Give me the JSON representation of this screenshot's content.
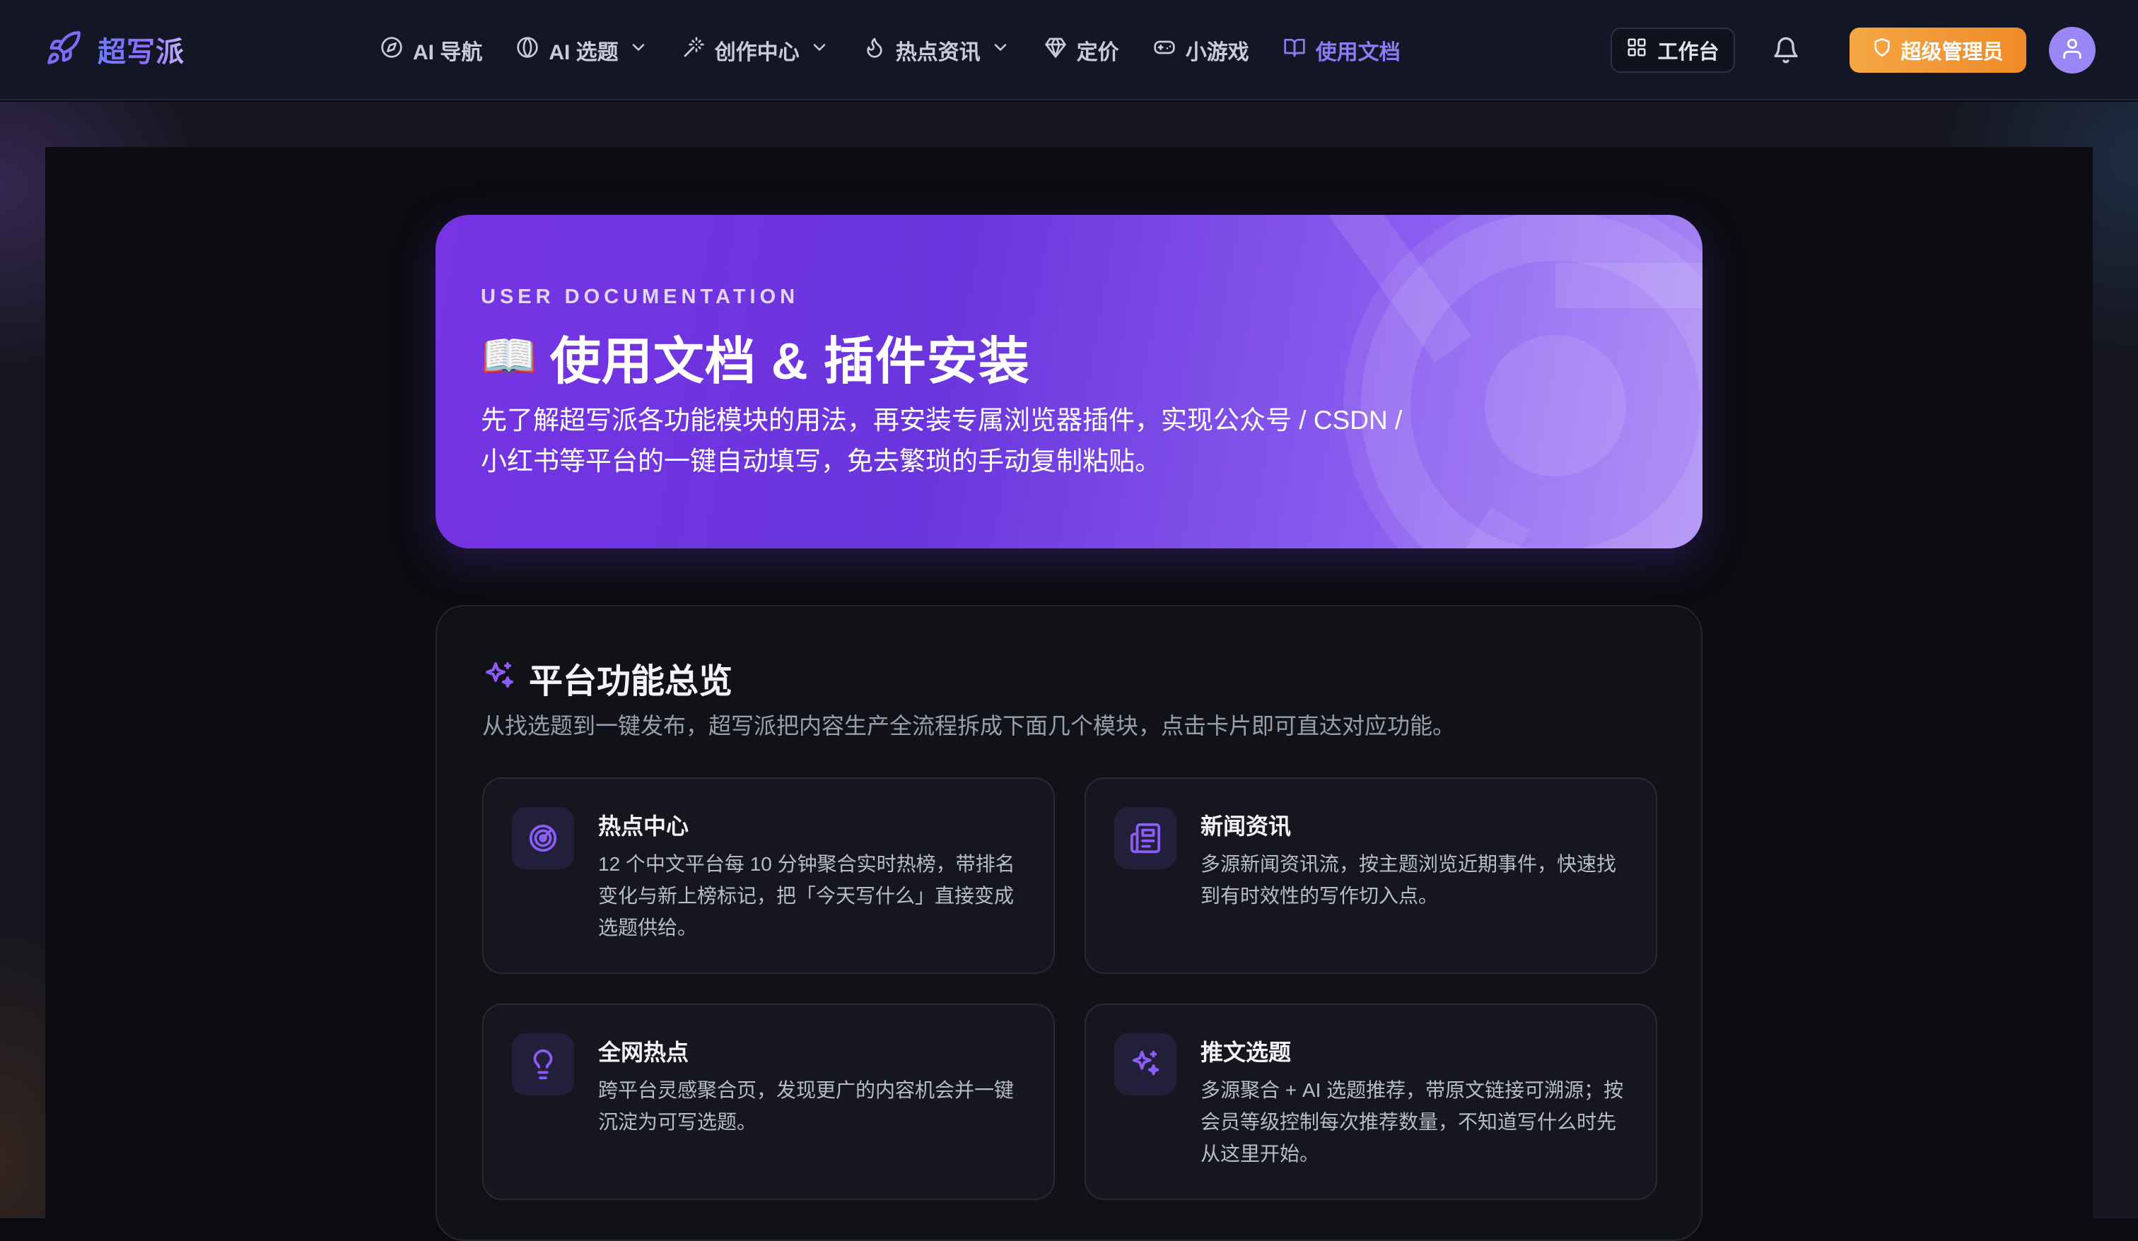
{
  "app": {
    "brand_name": "超写派",
    "icon": "rocket-icon"
  },
  "nav": {
    "items": [
      {
        "label": "AI 导航",
        "icon": "compass-icon",
        "has_dropdown": false,
        "active": false
      },
      {
        "label": "AI 选题",
        "icon": "globe-icon",
        "has_dropdown": true,
        "active": false
      },
      {
        "label": "创作中心",
        "icon": "magic-wand-icon",
        "has_dropdown": true,
        "active": false
      },
      {
        "label": "热点资讯",
        "icon": "flame-icon",
        "has_dropdown": true,
        "active": false
      },
      {
        "label": "定价",
        "icon": "diamond-icon",
        "has_dropdown": false,
        "active": false
      },
      {
        "label": "小游戏",
        "icon": "gamepad-icon",
        "has_dropdown": false,
        "active": true
      },
      {
        "label": "使用文档",
        "icon": "book-icon",
        "has_dropdown": false,
        "active": true
      }
    ]
  },
  "topbar": {
    "workspace_label": "工作台",
    "admin_label": "超级管理员",
    "bell_icon": "bell-icon",
    "avatar_icon": "user-icon"
  },
  "hero": {
    "eyebrow": "USER DOCUMENTATION",
    "emoji": "📖",
    "title": "使用文档 & 插件安装",
    "description": "先了解超写派各功能模块的用法，再安装专属浏览器插件，实现公众号 / CSDN / 小红书等平台的一键自动填写，免去繁琐的手动复制粘贴。"
  },
  "overview": {
    "icon": "sparkles-icon",
    "title": "平台功能总览",
    "subtitle": "从找选题到一键发布，超写派把内容生产全流程拆成下面几个模块，点击卡片即可直达对应功能。",
    "cards": [
      {
        "title": "热点中心",
        "icon": "radar-icon",
        "description": "12 个中文平台每 10 分钟聚合实时热榜，带排名变化与新上榜标记，把「今天写什么」直接变成选题供给。"
      },
      {
        "title": "新闻资讯",
        "icon": "newspaper-icon",
        "description": "多源新闻资讯流，按主题浏览近期事件，快速找到有时效性的写作切入点。"
      },
      {
        "title": "全网热点",
        "icon": "lightbulb-icon",
        "description": "跨平台灵感聚合页，发现更广的内容机会并一键沉淀为可写选题。"
      },
      {
        "title": "推文选题",
        "icon": "sparkles-icon",
        "description": "多源聚合 + AI 选题推荐，带原文链接可溯源；按会员等级控制每次推荐数量，不知道写什么时先从这里开始。"
      }
    ]
  },
  "colors": {
    "accent": "#8b7cf6",
    "hero_gradient_start": "#7634e3",
    "hero_gradient_end": "#a988f5",
    "admin_button": "#f5a742",
    "background": "#0b0c11"
  }
}
